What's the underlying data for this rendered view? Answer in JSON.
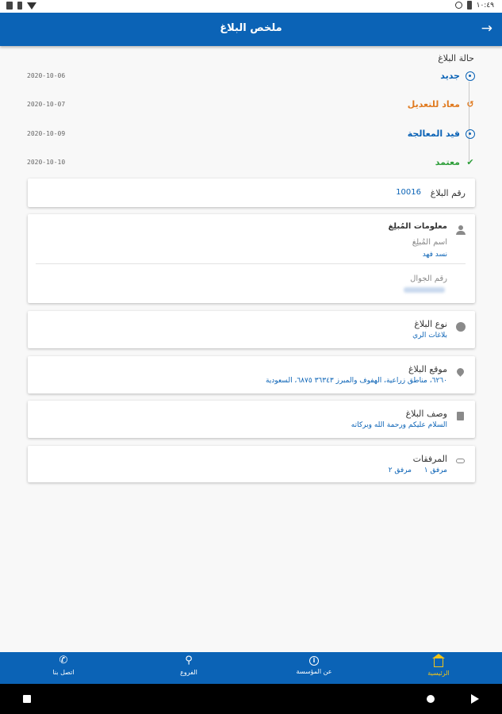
{
  "status_bar": {
    "time": "١٠:٤٩"
  },
  "app_bar": {
    "title": "ملخص البلاغ",
    "back_glyph": "→"
  },
  "status_section": {
    "heading": "حالة البلاغ",
    "timeline": [
      {
        "label": "جديد",
        "date": "2020-10-06",
        "color": "#0b63b6",
        "icon": "new-status-icon"
      },
      {
        "label": "معاد للتعديل",
        "date": "2020-10-07",
        "color": "#e07a1f",
        "icon": "undo-icon"
      },
      {
        "label": "قيد المعالجة",
        "date": "2020-10-09",
        "color": "#0b63b6",
        "icon": "processing-icon"
      },
      {
        "label": "معتمد",
        "date": "2020-10-10",
        "color": "#2e9e3a",
        "icon": "check-icon"
      }
    ]
  },
  "report_number": {
    "label": "رقم البلاغ",
    "value": "10016"
  },
  "reporter": {
    "title": "معلومات المُبلِغ",
    "name_label": "اسم المُبلِغ",
    "name_value": "نسد فهد",
    "phone_label": "رقم الجوال"
  },
  "report_type": {
    "title": "نوع البلاغ",
    "value": "بلاغات الري"
  },
  "location": {
    "title": "موقع البلاغ",
    "value": "٦٢٦٠، مناطق زراعية، الهفوف والمبرز ٣٦٣٤٣ ٦٨٧٥، السعودية"
  },
  "description": {
    "title": "وصف البلاغ",
    "value": "السلام عليكم ورحمة الله وبركاته"
  },
  "attachments": {
    "title": "المرفقات",
    "items": [
      "مرفق ١",
      "مرفق ٢"
    ]
  },
  "bottom_nav": [
    {
      "label": "الرئيسية",
      "icon": "home-icon",
      "active": true
    },
    {
      "label": "عن المؤسسة",
      "icon": "info-icon",
      "active": false
    },
    {
      "label": "الفروع",
      "icon": "branches-icon",
      "active": false
    },
    {
      "label": "اتصل بنا",
      "icon": "phone-icon",
      "active": false
    }
  ],
  "colors": {
    "primary": "#0b63b6",
    "active_nav": "#f0c419",
    "returned": "#e07a1f",
    "approved": "#2e9e3a"
  }
}
